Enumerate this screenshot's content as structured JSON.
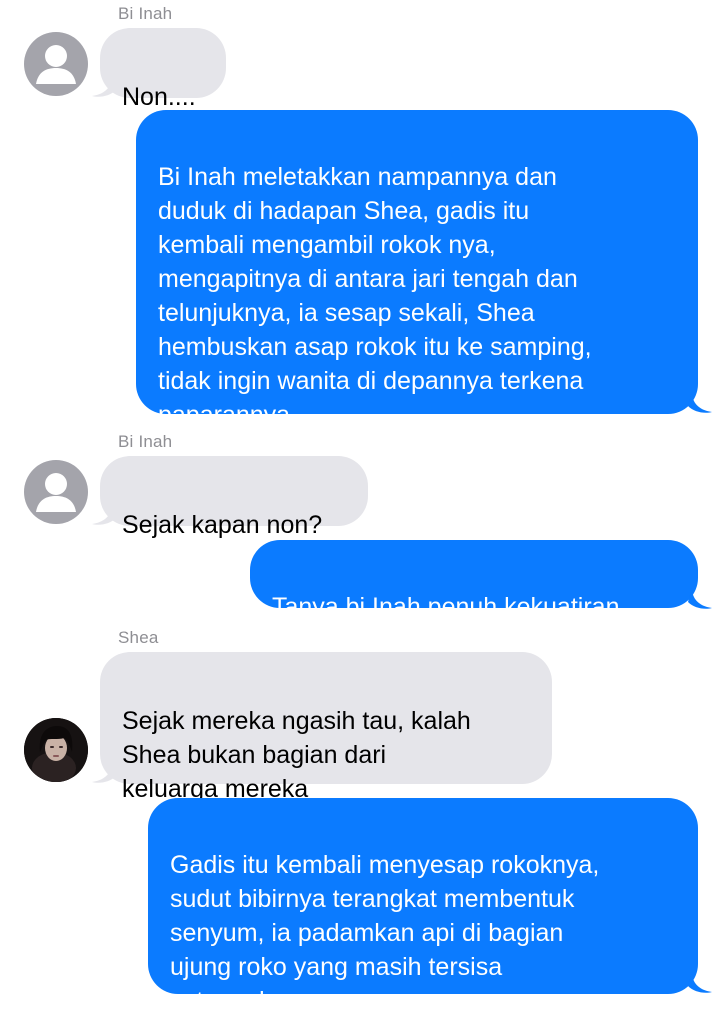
{
  "messages": [
    {
      "type": "incoming",
      "sender": "Bi Inah",
      "avatar": "default-person-icon",
      "text": "Non...."
    },
    {
      "type": "outgoing",
      "text": "Bi Inah meletakkan nampannya dan\nduduk di hadapan Shea, gadis itu\nkembali mengambil rokok nya,\nmengapitnya di antara jari tengah dan\ntelunjuknya, ia sesap sekali, Shea\nhembuskan asap rokok itu ke samping,\ntidak ingin wanita di depannya terkena\npaparannya"
    },
    {
      "type": "incoming",
      "sender": "Bi Inah",
      "avatar": "default-person-icon",
      "text": "Sejak kapan non?"
    },
    {
      "type": "outgoing",
      "text": "Tanya bi Inah penuh kekuatiran"
    },
    {
      "type": "incoming",
      "sender": "Shea",
      "avatar": "profile-photo",
      "text": "Sejak mereka ngasih tau, kalah\nShea bukan bagian dari\nkeluarga mereka"
    },
    {
      "type": "outgoing",
      "text": "Gadis itu kembali menyesap rokoknya,\nsudut bibirnya terangkat membentuk\nsenyum, ia padamkan api di bagian\nujung roko yang masih tersisa\nsetengah"
    }
  ],
  "colors": {
    "incoming_bubble": "#e5e5ea",
    "outgoing_bubble": "#0b7bff",
    "sender_name": "#8e8e93"
  }
}
